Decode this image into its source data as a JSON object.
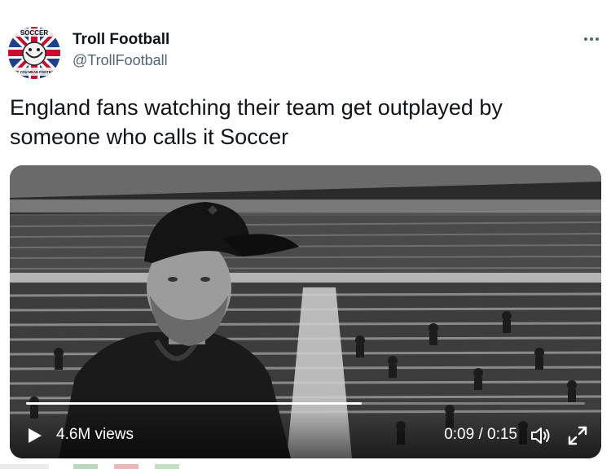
{
  "author": {
    "display_name": "Troll Football",
    "handle": "@TrollFootball",
    "avatar_text_top": "SOCCER",
    "avatar_text_bottom": "DON'T YOU MEAN FOOTBALL?"
  },
  "tweet": {
    "text": "England fans watching their team get outplayed by someone who calls it Soccer"
  },
  "video": {
    "views": "4.6M views",
    "time": "0:09 / 0:15",
    "progress": 0.6
  },
  "icons": {
    "more": "more-icon",
    "play": "play-icon",
    "volume": "volume-icon",
    "fullscreen": "fullscreen-icon"
  }
}
